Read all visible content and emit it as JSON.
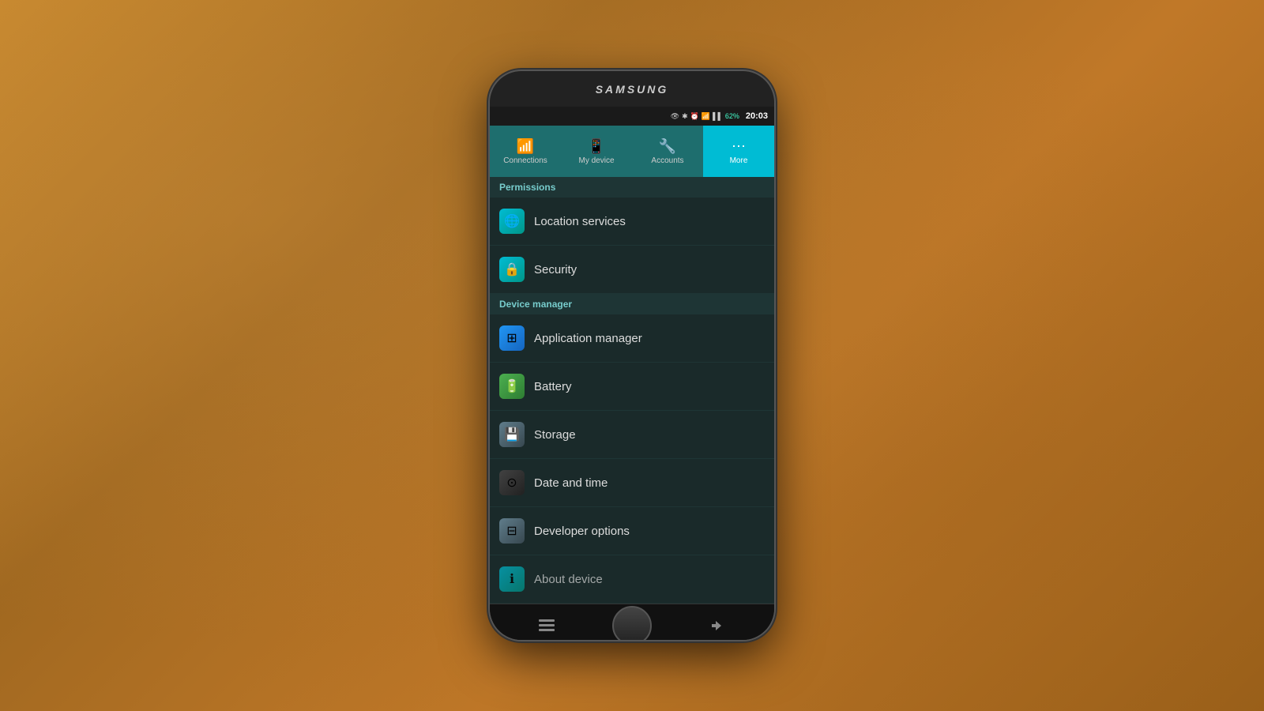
{
  "device": {
    "brand": "SAMSUNG"
  },
  "status_bar": {
    "time": "20:03",
    "battery_percent": "62%"
  },
  "tabs": [
    {
      "id": "connections",
      "label": "Connections",
      "icon": "📶",
      "active": false
    },
    {
      "id": "my_device",
      "label": "My device",
      "icon": "📱",
      "active": false
    },
    {
      "id": "accounts",
      "label": "Accounts",
      "icon": "🔧",
      "active": false
    },
    {
      "id": "more",
      "label": "More",
      "icon": "⋯",
      "active": true
    }
  ],
  "sections": [
    {
      "id": "permissions",
      "header": "Permissions",
      "items": [
        {
          "id": "location_services",
          "label": "Location services",
          "icon": "🌐",
          "icon_class": "teal"
        },
        {
          "id": "security",
          "label": "Security",
          "icon": "🔒",
          "icon_class": "teal"
        }
      ]
    },
    {
      "id": "device_manager",
      "header": "Device manager",
      "items": [
        {
          "id": "application_manager",
          "label": "Application manager",
          "icon": "⊞",
          "icon_class": "blue"
        },
        {
          "id": "battery",
          "label": "Battery",
          "icon": "🔋",
          "icon_class": "green"
        },
        {
          "id": "storage",
          "label": "Storage",
          "icon": "💾",
          "icon_class": "gray"
        },
        {
          "id": "date_and_time",
          "label": "Date and time",
          "icon": "⊙",
          "icon_class": "dark"
        },
        {
          "id": "developer_options",
          "label": "Developer options",
          "icon": "⊟",
          "icon_class": "gray"
        },
        {
          "id": "about_device",
          "label": "About device",
          "icon": "ℹ",
          "icon_class": "teal"
        }
      ]
    }
  ]
}
